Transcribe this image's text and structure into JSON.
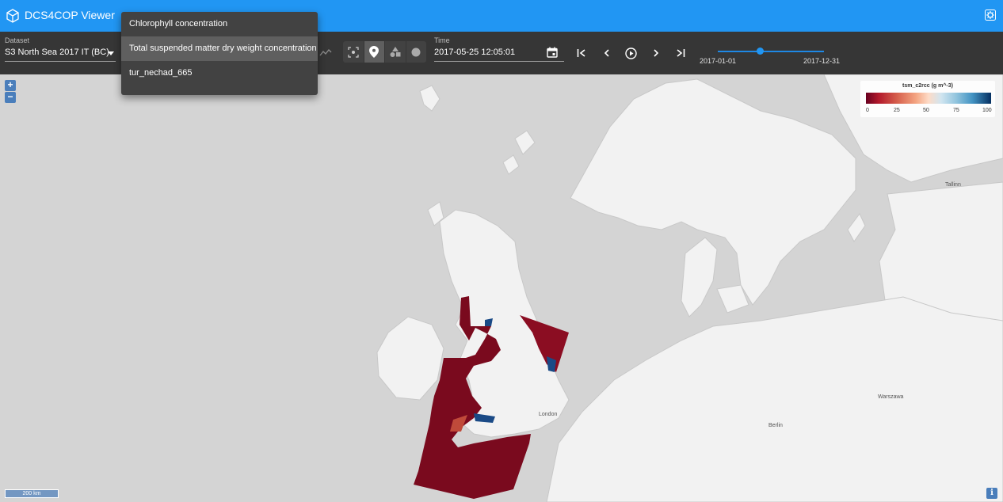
{
  "app": {
    "title": "DCS4COP Viewer"
  },
  "dataset": {
    "label": "Dataset",
    "value": "S3 North Sea 2017 IT (BC)"
  },
  "variable_menu": {
    "items": [
      {
        "label": "Chlorophyll concentration"
      },
      {
        "label": "Total suspended matter dry weight concentration",
        "selected": true
      },
      {
        "label": "tur_nechad_665"
      }
    ]
  },
  "time": {
    "label": "Time",
    "value": "2017-05-25 12:05:01"
  },
  "time_slider": {
    "start": "2017-01-01",
    "end": "2017-12-31",
    "position_fraction": 0.4
  },
  "legend": {
    "title": "tsm_c2rcc (g m^-3)",
    "ticks": [
      "0",
      "25",
      "50",
      "75",
      "100"
    ]
  },
  "map": {
    "scale_label": "200 km",
    "zoom_in": "+",
    "zoom_out": "−",
    "info": "i",
    "place_labels": [
      {
        "name": "Warszawa"
      },
      {
        "name": "Berlin"
      },
      {
        "name": "Tallinn"
      },
      {
        "name": "London"
      }
    ]
  },
  "colors": {
    "app_bar": "#2196f3",
    "toolbar": "#363636",
    "menu": "#424242",
    "overlay_red": "#7a0a1e",
    "overlay_blue": "#1a4a86"
  }
}
